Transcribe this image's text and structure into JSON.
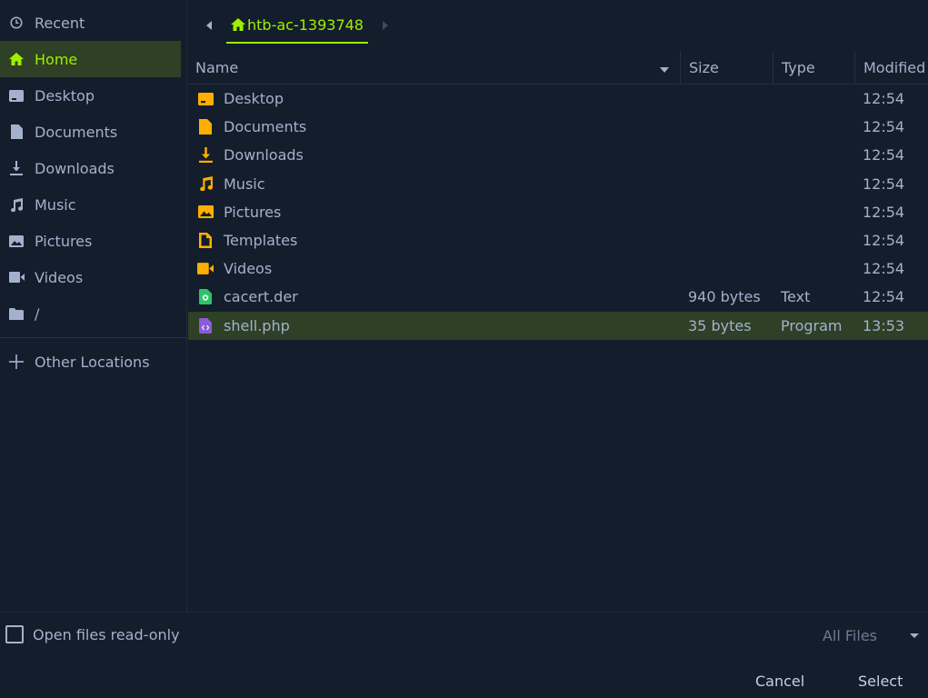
{
  "sidebar": {
    "items": [
      {
        "label": "Recent",
        "icon": "clock-icon"
      },
      {
        "label": "Home",
        "icon": "home-icon"
      },
      {
        "label": "Desktop",
        "icon": "desktop-icon"
      },
      {
        "label": "Documents",
        "icon": "document-icon"
      },
      {
        "label": "Downloads",
        "icon": "download-icon"
      },
      {
        "label": "Music",
        "icon": "music-icon"
      },
      {
        "label": "Pictures",
        "icon": "picture-icon"
      },
      {
        "label": "Videos",
        "icon": "video-icon"
      },
      {
        "label": "/",
        "icon": "folder-icon"
      }
    ],
    "other_locations": "Other Locations"
  },
  "pathbar": {
    "crumb": "htb-ac-1393748"
  },
  "columns": {
    "name": "Name",
    "size": "Size",
    "type": "Type",
    "modified": "Modified"
  },
  "files": [
    {
      "name": "Desktop",
      "size": "",
      "type": "",
      "modified": "12:54",
      "icon": "desktop-folder-icon"
    },
    {
      "name": "Documents",
      "size": "",
      "type": "",
      "modified": "12:54",
      "icon": "document-folder-icon"
    },
    {
      "name": "Downloads",
      "size": "",
      "type": "",
      "modified": "12:54",
      "icon": "download-folder-icon"
    },
    {
      "name": "Music",
      "size": "",
      "type": "",
      "modified": "12:54",
      "icon": "music-folder-icon"
    },
    {
      "name": "Pictures",
      "size": "",
      "type": "",
      "modified": "12:54",
      "icon": "pictures-folder-icon"
    },
    {
      "name": "Templates",
      "size": "",
      "type": "",
      "modified": "12:54",
      "icon": "templates-folder-icon"
    },
    {
      "name": "Videos",
      "size": "",
      "type": "",
      "modified": "12:54",
      "icon": "videos-folder-icon"
    },
    {
      "name": "cacert.der",
      "size": "940 bytes",
      "type": "Text",
      "modified": "12:54",
      "icon": "certificate-file-icon"
    },
    {
      "name": "shell.php",
      "size": "35 bytes",
      "type": "Program",
      "modified": "13:53",
      "icon": "php-file-icon"
    }
  ],
  "footer": {
    "readonly_label": "Open files read-only",
    "filter_label": "All Files",
    "cancel_label": "Cancel",
    "select_label": "Select"
  },
  "colors": {
    "accent": "#9fef00",
    "background": "#141d2b",
    "folder": "#ffaf00",
    "selected": "#2e4026"
  }
}
